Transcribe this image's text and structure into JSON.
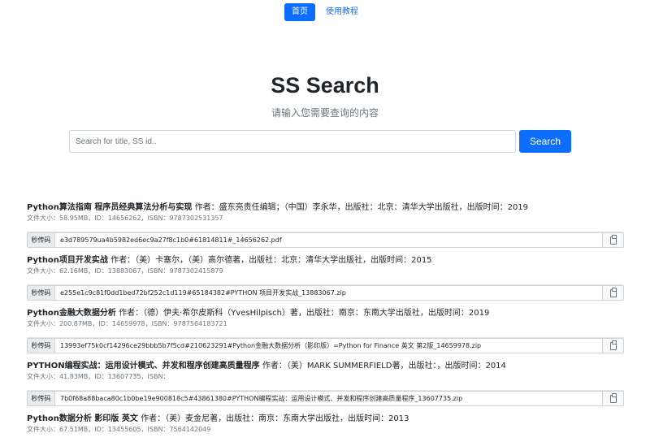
{
  "nav": {
    "home": "首页",
    "tutorial": "使用教程"
  },
  "hero": {
    "title": "SS Search",
    "subtitle": "请输入您需要查询的内容"
  },
  "search": {
    "placeholder": "Search for title, SS id..",
    "value": "",
    "button": "Search"
  },
  "copy_label": "秒传码",
  "colors": {
    "accent": "#0d6efd"
  },
  "icons": {
    "copy": "clipboard-icon"
  },
  "results": [
    {
      "title": "Python算法指南 程序员经典算法分析与实现",
      "info": " 作者：盛东亮责任编辑；（中国）李永华，出版社：北京：清华大学出版社，出版时间：2019",
      "meta": "文件大小：58.95MB，ID：14656262，ISBN：9787302531357",
      "code": "e3d789579ua4b5982ed6ec9a27f8c1b0#61814811#_14656262.pdf"
    },
    {
      "title": "Python项目开发实战",
      "info": " 作者：（美）卡塞尔，（美）高尔德著，出版社：北京：清华大学出版社，出版时间：2015",
      "meta": "文件大小：62.16MB，ID：13883067，ISBN：9787302415879",
      "code": "e255e1c9c81f0dd1bed72bf252c1d119#65184382#PYTHON 项目开发实战_13883067.zip"
    },
    {
      "title": "Python金融大数据分析",
      "info": " 作者：（德）伊夫·希尔皮斯科（YvesHilpisch）著，出版社：南京：东南大学出版社，出版时间：2019",
      "meta": "文件大小：200.87MB，ID：14659978，ISBN：9787564183721",
      "code": "13993ef75k0cf14296ce29bbb5b7f5cd#210623291#Python金融大数据分析（影印版）=Python for Finance 英文 第2版_14659978.zip"
    },
    {
      "title": "PYTHON编程实战：运用设计模式、并发和程序创建高质量程序",
      "info": " 作者：（美）MARK SUMMERFIELD著，出版社：，出版时间：2014",
      "meta": "文件大小：41.83MB，ID：13607735，ISBN：",
      "code": "7b0f68a88baca80c1b0be19e900818c5#43861380#PYTHON编程实战：运用设计模式、并发和程序创建高质量程序_13607735.zip"
    },
    {
      "title": "Python数据分析 影印版 英文",
      "info": " 作者：（美）麦金尼著，出版社：南京：东南大学出版社，出版时间：2013",
      "meta": "文件大小：67.51MB，ID：13455605，ISBN：7564142049",
      "code": ""
    }
  ]
}
